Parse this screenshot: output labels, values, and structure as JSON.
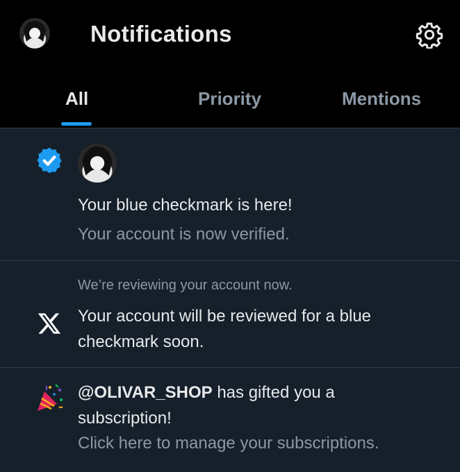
{
  "header": {
    "title": "Notifications",
    "tabs": [
      {
        "label": "All",
        "active": true
      },
      {
        "label": "Priority",
        "active": false
      },
      {
        "label": "Mentions",
        "active": false
      }
    ]
  },
  "notifications": [
    {
      "type": "verified",
      "icon": "verified-badge-icon",
      "title": "Your blue checkmark is here!",
      "subtitle": "Your account is now verified."
    },
    {
      "type": "review",
      "icon": "x-logo-icon",
      "preface": "We’re reviewing your account now.",
      "line1": "Your account will be reviewed for a blue",
      "line2": "checkmark soon."
    },
    {
      "type": "gift",
      "icon": "party-popper-icon",
      "handle": "@OLIVAR_SHOP",
      "line1_rest": " has gifted you a",
      "line2": "subscription!",
      "subtitle": "Click here to manage your subscriptions."
    }
  ],
  "colors": {
    "background": "#15202b",
    "header": "#000000",
    "accent": "#1d9bf0",
    "text_primary": "#e7e9ea",
    "text_secondary": "#8b98a5"
  }
}
